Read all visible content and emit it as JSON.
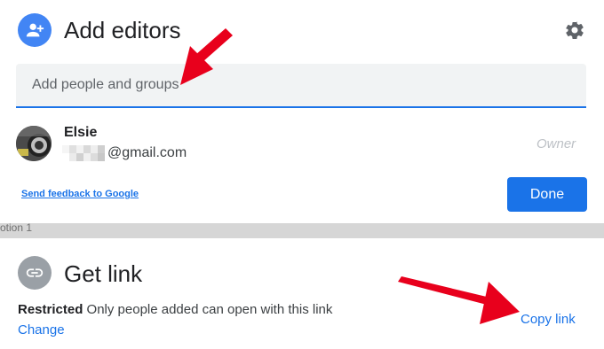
{
  "dialog": {
    "title": "Add editors",
    "settings_icon": "gear-icon",
    "add_icon": "person-add-icon",
    "search": {
      "placeholder": "Add people and groups",
      "value": ""
    },
    "people": [
      {
        "name": "Elsie",
        "email_suffix": "@gmail.com",
        "role": "Owner",
        "avatar_icon": "avatar-photo"
      }
    ],
    "feedback_link": "Send feedback to Google",
    "done_label": "Done"
  },
  "band": {
    "text": "otion 1"
  },
  "get_link": {
    "title": "Get link",
    "icon": "link-icon",
    "restriction_label": "Restricted",
    "restriction_desc": " Only people added can open with this link",
    "change_label": "Change",
    "copy_label": "Copy link"
  },
  "annotations": {
    "arrow_color": "#e8001c",
    "arrow_icon": "red-arrow"
  },
  "colors": {
    "accent": "#1a73e8",
    "avatar_bg": "#4285f4",
    "link_circle": "#9aa0a6"
  }
}
